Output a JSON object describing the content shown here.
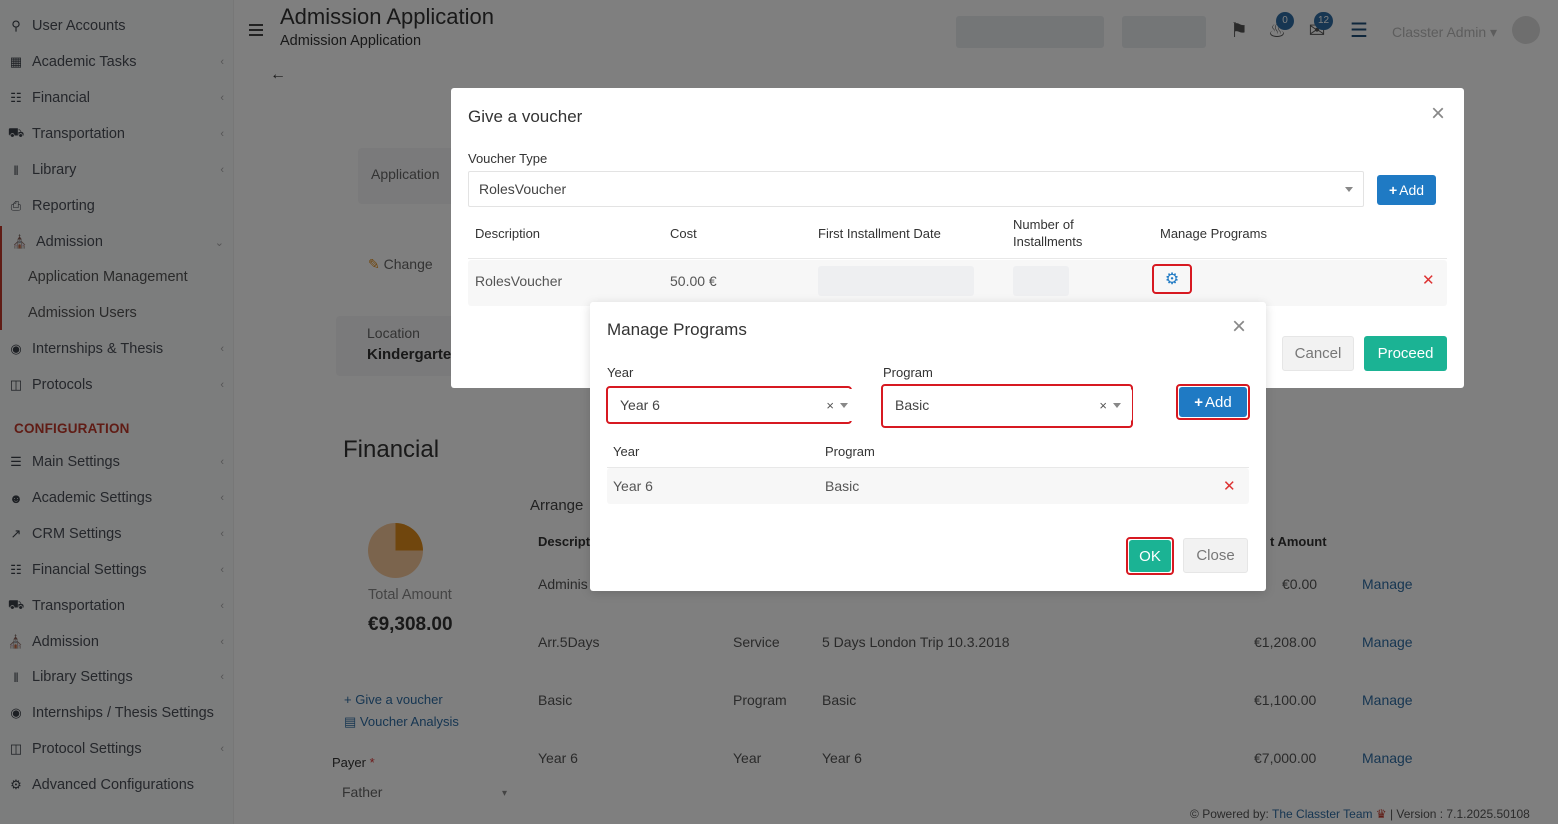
{
  "sidebar": {
    "items": [
      {
        "label": "User Accounts",
        "icon": "key-icon"
      },
      {
        "label": "Academic Tasks",
        "icon": "grid-icon"
      },
      {
        "label": "Financial",
        "icon": "money-icon"
      },
      {
        "label": "Transportation",
        "icon": "bus-icon"
      },
      {
        "label": "Library",
        "icon": "books-icon"
      },
      {
        "label": "Reporting",
        "icon": "printer-icon"
      },
      {
        "label": "Admission",
        "icon": "building-icon"
      },
      {
        "label": "Internships & Thesis",
        "icon": "graduation-icon"
      },
      {
        "label": "Protocols",
        "icon": "protocol-icon"
      }
    ],
    "admission_sub": [
      "Application Management",
      "Admission Users"
    ],
    "config_header": "CONFIGURATION",
    "config_items": [
      {
        "label": "Main Settings",
        "icon": "sliders-icon"
      },
      {
        "label": "Academic Settings",
        "icon": "users-icon"
      },
      {
        "label": "CRM Settings",
        "icon": "chart-icon"
      },
      {
        "label": "Financial Settings",
        "icon": "money-icon"
      },
      {
        "label": "Transportation",
        "icon": "bus-icon"
      },
      {
        "label": "Admission",
        "icon": "building-icon"
      },
      {
        "label": "Library Settings",
        "icon": "books-icon"
      },
      {
        "label": "Internships / Thesis Settings",
        "icon": "graduation-icon"
      },
      {
        "label": "Protocol Settings",
        "icon": "protocol-icon"
      },
      {
        "label": "Advanced Configurations",
        "icon": "gears-icon"
      }
    ]
  },
  "topbar": {
    "title": "Admission Application",
    "subtitle": "Admission Application",
    "notifications_count": "0",
    "messages_count": "12",
    "user_name": "Classter Admin"
  },
  "background": {
    "application_label": "Application",
    "change_label": "Change",
    "location_label": "Location",
    "location_value": "Kindergarte",
    "financial_heading": "Financial",
    "arrange_label": "Arrange",
    "total_amount_label": "Total Amount",
    "total_amount_value": "€9,308.00",
    "give_voucher_link": "Give a voucher",
    "voucher_analysis_link": "Voucher Analysis",
    "payer_label": "Payer",
    "payer_value": "Father",
    "table_headers": {
      "description": "Descripti",
      "amount": "t Amount"
    },
    "rows": [
      {
        "desc": "Adminis",
        "type": "",
        "item": "",
        "amount": "€0.00",
        "action": "Manage"
      },
      {
        "desc": "Arr.5Days",
        "type": "Service",
        "item": "5 Days London Trip 10.3.2018",
        "amount": "€1,208.00",
        "action": "Manage"
      },
      {
        "desc": "Basic",
        "type": "Program",
        "item": "Basic",
        "amount": "€1,100.00",
        "action": "Manage"
      },
      {
        "desc": "Year 6",
        "type": "Year",
        "item": "Year 6",
        "amount": "€7,000.00",
        "action": "Manage"
      }
    ],
    "footer_powered": "Powered by:",
    "footer_team": "The Classter Team",
    "footer_version": "| Version : 7.1.2025.50108"
  },
  "voucher_modal": {
    "title": "Give a voucher",
    "voucher_type_label": "Voucher Type",
    "voucher_type_value": "RolesVoucher",
    "add_label": "Add",
    "headers": {
      "description": "Description",
      "cost": "Cost",
      "first_installment": "First Installment Date",
      "num_installments_1": "Number of",
      "num_installments_2": "Installments",
      "manage_programs": "Manage Programs"
    },
    "row": {
      "description": "RolesVoucher",
      "cost": "50.00 €"
    },
    "cancel_label": "Cancel",
    "proceed_label": "Proceed"
  },
  "programs_modal": {
    "title": "Manage Programs",
    "year_label": "Year",
    "year_value": "Year 6",
    "program_label": "Program",
    "program_value": "Basic",
    "add_label": "Add",
    "headers": {
      "year": "Year",
      "program": "Program"
    },
    "rows": [
      {
        "year": "Year 6",
        "program": "Basic"
      }
    ],
    "ok_label": "OK",
    "close_label": "Close"
  }
}
